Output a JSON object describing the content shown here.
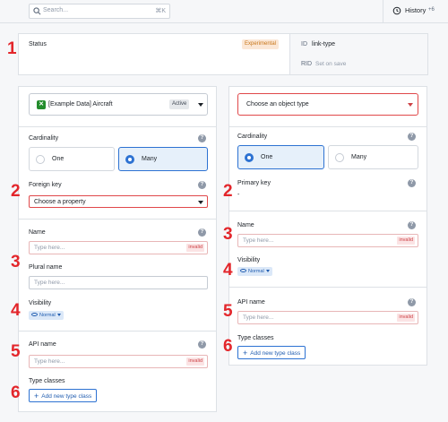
{
  "topbar": {
    "search_placeholder": "Search...",
    "search_shortcut": "⌘K",
    "history_label": "History",
    "history_count": "+6"
  },
  "status": {
    "label": "Status",
    "badge": "Experimental",
    "id_label": "ID",
    "id_value": "link-type",
    "rid_label": "RID",
    "rid_value": "Set on save"
  },
  "left": {
    "object_name": "[Example Data] Aircraft",
    "object_badge": "Active",
    "cardinality_label": "Cardinality",
    "cardinality_options": [
      "One",
      "Many"
    ],
    "cardinality_selected": "Many",
    "key_label": "Foreign key",
    "key_placeholder": "Choose a property",
    "name_label": "Name",
    "name_placeholder": "Type here...",
    "name_error": "invalid",
    "plural_label": "Plural name",
    "plural_placeholder": "Type here...",
    "visibility_label": "Visibility",
    "visibility_value": "Normal",
    "api_label": "API name",
    "api_placeholder": "Type here...",
    "api_error": "invalid",
    "type_classes_label": "Type classes",
    "add_type_class": "Add new type class"
  },
  "right": {
    "object_placeholder": "Choose an object type",
    "cardinality_label": "Cardinality",
    "cardinality_options": [
      "One",
      "Many"
    ],
    "cardinality_selected": "One",
    "key_label": "Primary key",
    "key_value": "-",
    "name_label": "Name",
    "name_placeholder": "Type here...",
    "name_error": "invalid",
    "visibility_label": "Visibility",
    "visibility_value": "Normal",
    "api_label": "API name",
    "api_placeholder": "Type here...",
    "api_error": "invalid",
    "type_classes_label": "Type classes",
    "add_type_class": "Add new type class"
  },
  "annotations": [
    "1",
    "2",
    "3",
    "4",
    "5",
    "6"
  ],
  "colors": {
    "accent": "#2d72d2",
    "error": "#cd4246",
    "annotation": "#e3262b",
    "page_bg": "#f6f7f9"
  }
}
